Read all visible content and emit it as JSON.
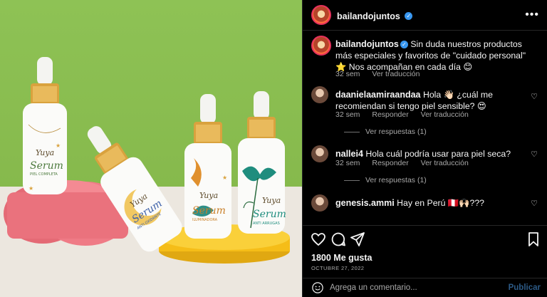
{
  "post": {
    "image_alt": "Yuya Serum bottles on pink and yellow stands",
    "bottle_labels": {
      "brand": "Yuya",
      "product": "Serum",
      "variants": [
        "PIEL COMPLETA",
        "ANTI OXIDANTE",
        "ILUMINADORA",
        "ANTI ARRUGAS"
      ]
    }
  },
  "header": {
    "username": "bailandojuntos",
    "more_label": "•••"
  },
  "caption": {
    "username": "bailandojuntos",
    "text": "Sin duda nuestros productos más especiales y favoritos de \"cuidado personal\" ⭐ Nos acompañan en cada día 😊",
    "time": "32 sem",
    "translate": "Ver traducción"
  },
  "comments": [
    {
      "username": "daanielaamiraandaa",
      "text": "Hola 👋🏻 ¿cuál me recomiendan si tengo piel sensible? 😍",
      "time": "32 sem",
      "reply": "Responder",
      "translate": "Ver traducción",
      "replies": "Ver respuestas (1)"
    },
    {
      "username": "nallei4",
      "text": "Hola cuál podría usar para piel seca?",
      "time": "32 sem",
      "reply": "Responder",
      "translate": "Ver traducción",
      "replies": "Ver respuestas (1)"
    },
    {
      "username": "genesis.ammi",
      "text": "Hay en Perú 🇵🇪🙌🏻???",
      "time": "",
      "reply": "",
      "translate": "",
      "replies": ""
    }
  ],
  "footer": {
    "likes": "1800 Me gusta",
    "date": "OCTUBRE 27, 2022",
    "comment_placeholder": "Agrega un comentario...",
    "post_label": "Publicar"
  },
  "colors": {
    "accent": "#3897f0",
    "background": "#000000",
    "wall": "#8ec255",
    "pink": "#ef7b86",
    "yellow": "#f7c21e"
  }
}
